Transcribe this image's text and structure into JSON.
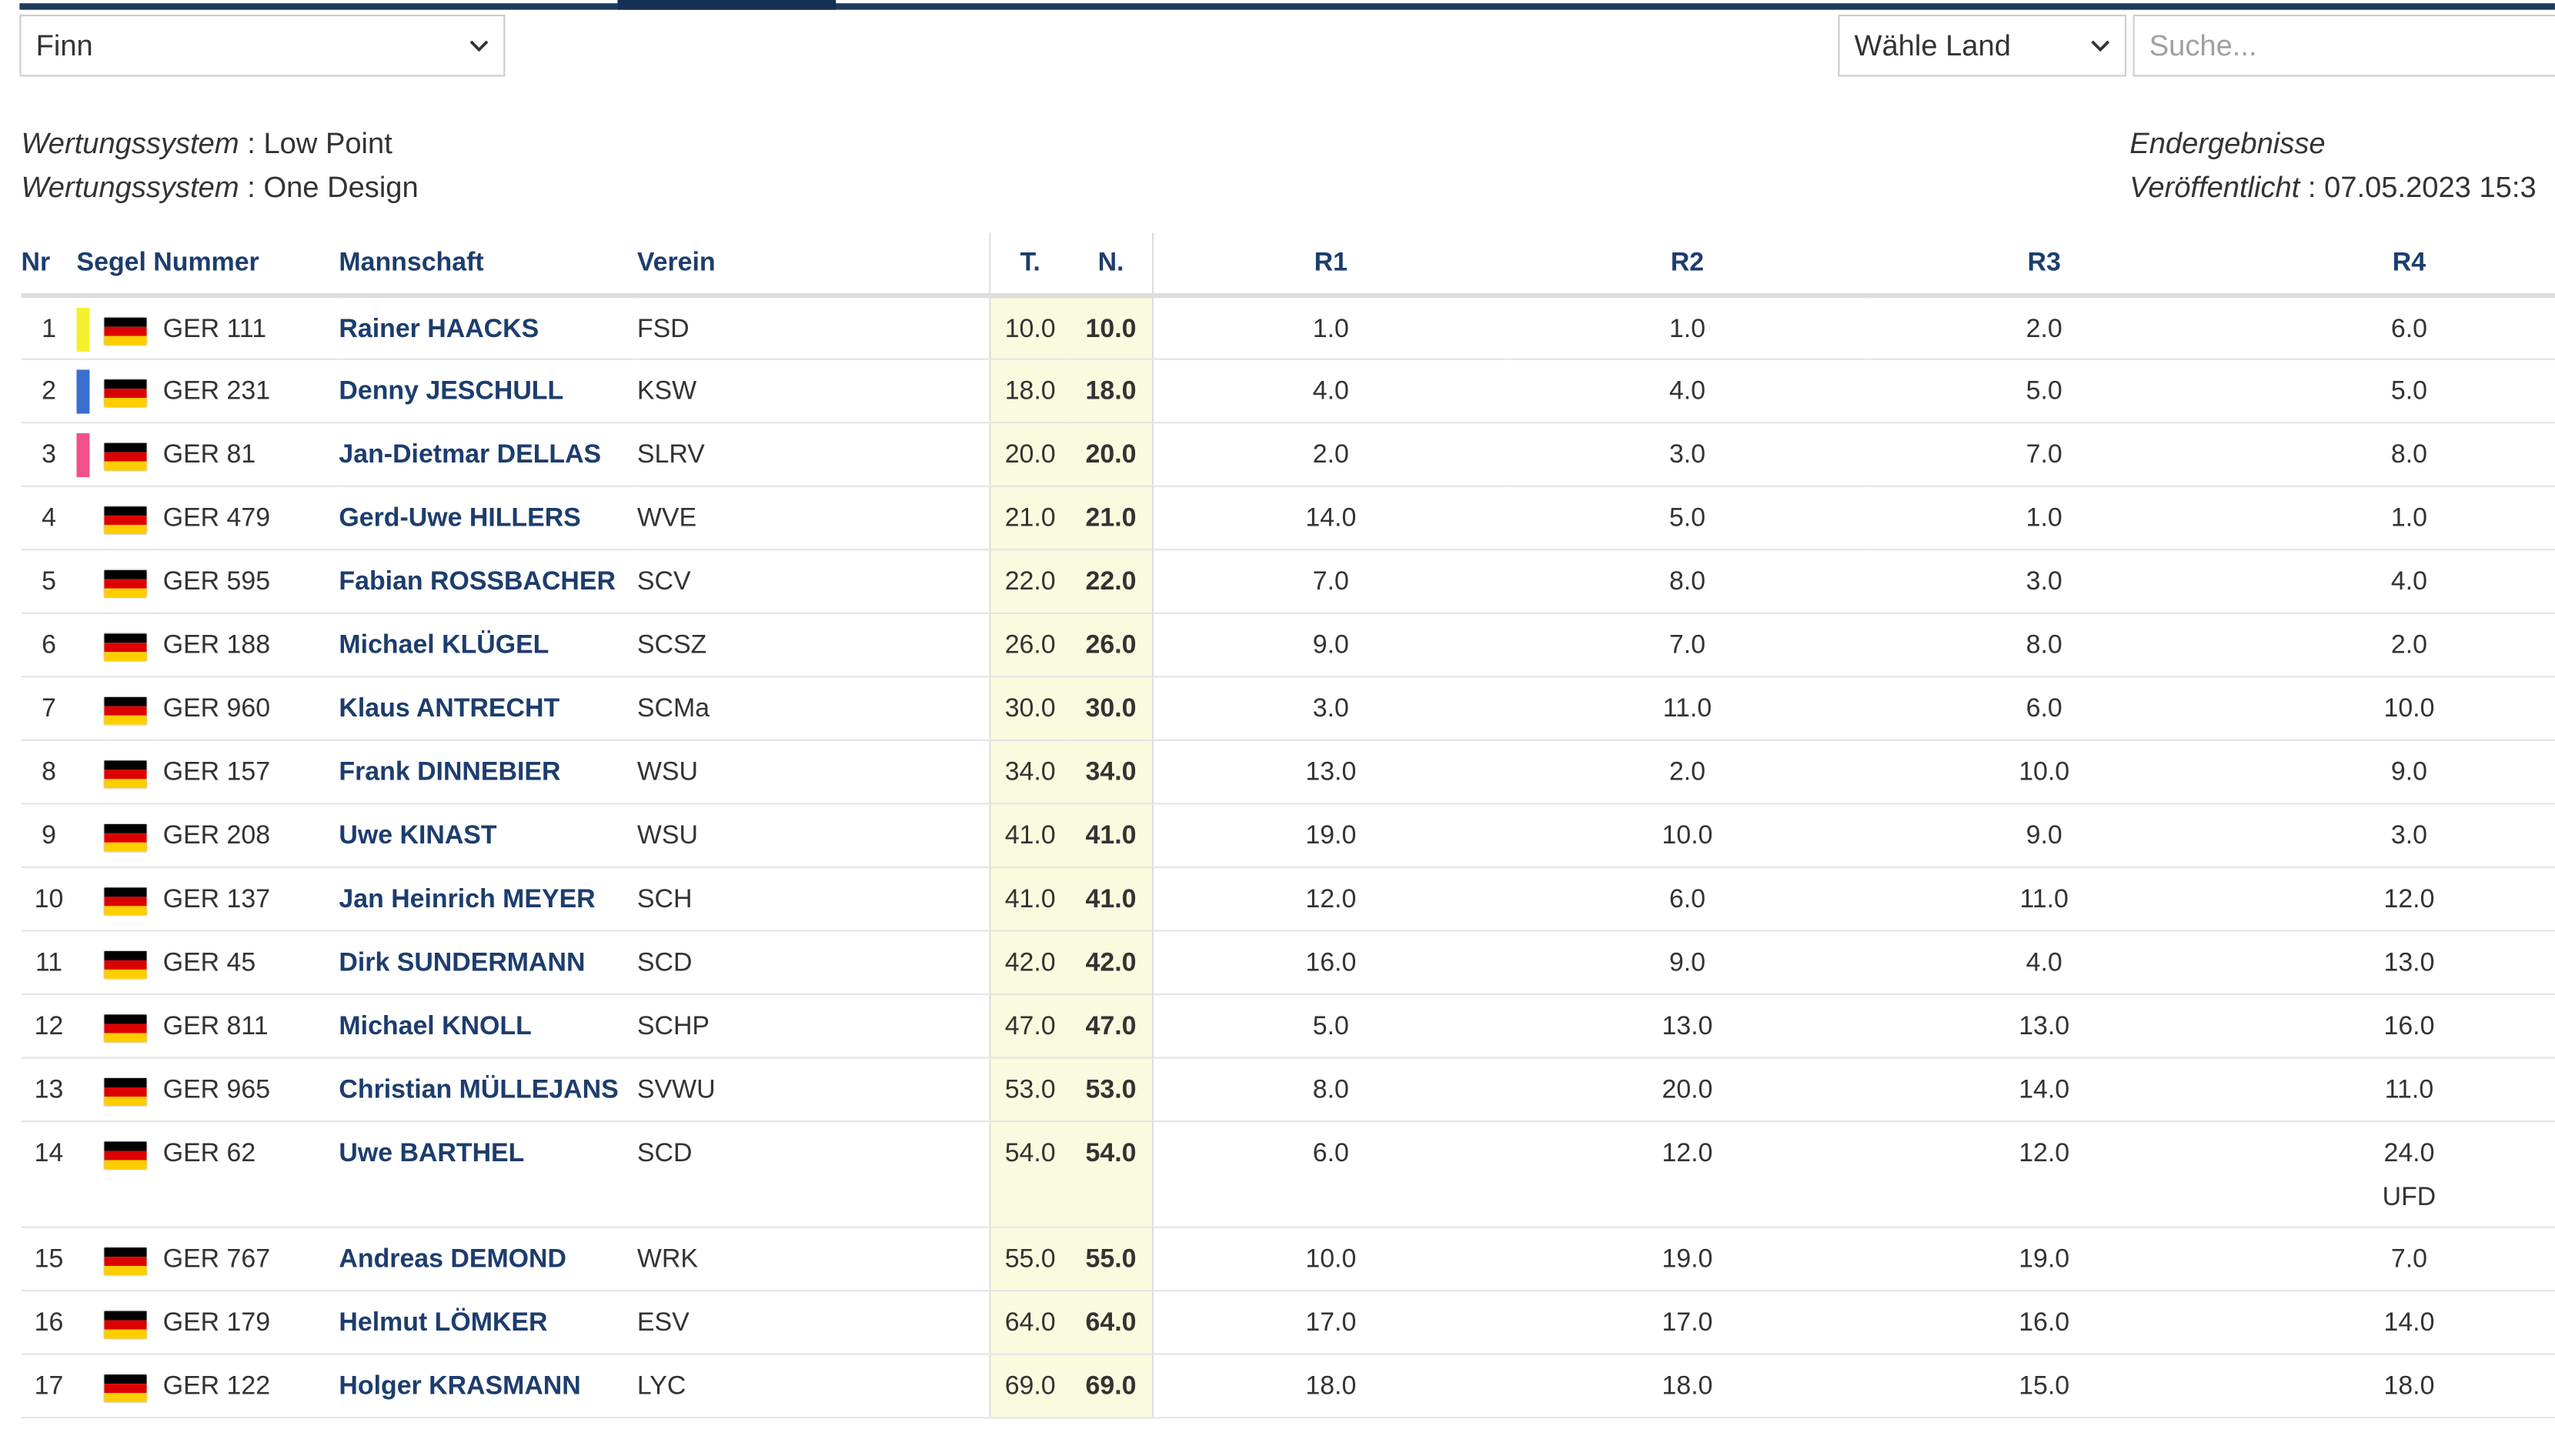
{
  "controls": {
    "class_select": "Finn",
    "country_select": "Wähle Land",
    "search_placeholder": "Suche..."
  },
  "info": {
    "scoring_label": "Wertungssystem",
    "scoring_value_1": "Low Point",
    "scoring_value_2": "One Design",
    "status": "Endergebnisse",
    "published_label": "Veröffentlicht",
    "published_value": "07.05.2023 15:3"
  },
  "table": {
    "headers": {
      "nr": "Nr",
      "sail": "Segel Nummer",
      "crew": "Mannschaft",
      "club": "Verein",
      "total": "T.",
      "net": "N.",
      "r1": "R1",
      "r2": "R2",
      "r3": "R3",
      "r4": "R4"
    },
    "medal_colors": {
      "gold": "#f4f030",
      "silver": "#3a6fd0",
      "bronze": "#f0508c"
    },
    "flag_colors": [
      "#000000",
      "#dd0000",
      "#ffce00"
    ],
    "flag_icon": "germany-flag-icon",
    "rows": [
      {
        "nr": "1",
        "medal": "gold",
        "sail": "GER 111",
        "name": "Rainer HAACKS",
        "club": "FSD",
        "t": "10.0",
        "n": "10.0",
        "r1": "1.0",
        "r2": "1.0",
        "r3": "2.0",
        "r4": "6.0",
        "r4_note": ""
      },
      {
        "nr": "2",
        "medal": "silver",
        "sail": "GER 231",
        "name": "Denny JESCHULL",
        "club": "KSW",
        "t": "18.0",
        "n": "18.0",
        "r1": "4.0",
        "r2": "4.0",
        "r3": "5.0",
        "r4": "5.0",
        "r4_note": ""
      },
      {
        "nr": "3",
        "medal": "bronze",
        "sail": "GER 81",
        "name": "Jan-Dietmar DELLAS",
        "club": "SLRV",
        "t": "20.0",
        "n": "20.0",
        "r1": "2.0",
        "r2": "3.0",
        "r3": "7.0",
        "r4": "8.0",
        "r4_note": ""
      },
      {
        "nr": "4",
        "medal": "",
        "sail": "GER 479",
        "name": "Gerd-Uwe HILLERS",
        "club": "WVE",
        "t": "21.0",
        "n": "21.0",
        "r1": "14.0",
        "r2": "5.0",
        "r3": "1.0",
        "r4": "1.0",
        "r4_note": ""
      },
      {
        "nr": "5",
        "medal": "",
        "sail": "GER 595",
        "name": "Fabian ROSSBACHER",
        "club": "SCV",
        "t": "22.0",
        "n": "22.0",
        "r1": "7.0",
        "r2": "8.0",
        "r3": "3.0",
        "r4": "4.0",
        "r4_note": ""
      },
      {
        "nr": "6",
        "medal": "",
        "sail": "GER 188",
        "name": "Michael KLÜGEL",
        "club": "SCSZ",
        "t": "26.0",
        "n": "26.0",
        "r1": "9.0",
        "r2": "7.0",
        "r3": "8.0",
        "r4": "2.0",
        "r4_note": ""
      },
      {
        "nr": "7",
        "medal": "",
        "sail": "GER 960",
        "name": "Klaus ANTRECHT",
        "club": "SCMa",
        "t": "30.0",
        "n": "30.0",
        "r1": "3.0",
        "r2": "11.0",
        "r3": "6.0",
        "r4": "10.0",
        "r4_note": ""
      },
      {
        "nr": "8",
        "medal": "",
        "sail": "GER 157",
        "name": "Frank DINNEBIER",
        "club": "WSU",
        "t": "34.0",
        "n": "34.0",
        "r1": "13.0",
        "r2": "2.0",
        "r3": "10.0",
        "r4": "9.0",
        "r4_note": ""
      },
      {
        "nr": "9",
        "medal": "",
        "sail": "GER 208",
        "name": "Uwe KINAST",
        "club": "WSU",
        "t": "41.0",
        "n": "41.0",
        "r1": "19.0",
        "r2": "10.0",
        "r3": "9.0",
        "r4": "3.0",
        "r4_note": ""
      },
      {
        "nr": "10",
        "medal": "",
        "sail": "GER 137",
        "name": "Jan Heinrich MEYER",
        "club": "SCH",
        "t": "41.0",
        "n": "41.0",
        "r1": "12.0",
        "r2": "6.0",
        "r3": "11.0",
        "r4": "12.0",
        "r4_note": ""
      },
      {
        "nr": "11",
        "medal": "",
        "sail": "GER 45",
        "name": "Dirk SUNDERMANN",
        "club": "SCD",
        "t": "42.0",
        "n": "42.0",
        "r1": "16.0",
        "r2": "9.0",
        "r3": "4.0",
        "r4": "13.0",
        "r4_note": ""
      },
      {
        "nr": "12",
        "medal": "",
        "sail": "GER 811",
        "name": "Michael KNOLL",
        "club": "SCHP",
        "t": "47.0",
        "n": "47.0",
        "r1": "5.0",
        "r2": "13.0",
        "r3": "13.0",
        "r4": "16.0",
        "r4_note": ""
      },
      {
        "nr": "13",
        "medal": "",
        "sail": "GER 965",
        "name": "Christian MÜLLEJANS",
        "club": "SVWU",
        "t": "53.0",
        "n": "53.0",
        "r1": "8.0",
        "r2": "20.0",
        "r3": "14.0",
        "r4": "11.0",
        "r4_note": ""
      },
      {
        "nr": "14",
        "medal": "",
        "sail": "GER 62",
        "name": "Uwe BARTHEL",
        "club": "SCD",
        "t": "54.0",
        "n": "54.0",
        "r1": "6.0",
        "r2": "12.0",
        "r3": "12.0",
        "r4": "24.0",
        "r4_note": "UFD"
      },
      {
        "nr": "15",
        "medal": "",
        "sail": "GER 767",
        "name": "Andreas DEMOND",
        "club": "WRK",
        "t": "55.0",
        "n": "55.0",
        "r1": "10.0",
        "r2": "19.0",
        "r3": "19.0",
        "r4": "7.0",
        "r4_note": ""
      },
      {
        "nr": "16",
        "medal": "",
        "sail": "GER 179",
        "name": "Helmut LÖMKER",
        "club": "ESV",
        "t": "64.0",
        "n": "64.0",
        "r1": "17.0",
        "r2": "17.0",
        "r3": "16.0",
        "r4": "14.0",
        "r4_note": ""
      },
      {
        "nr": "17",
        "medal": "",
        "sail": "GER 122",
        "name": "Holger KRASMANN",
        "club": "LYC",
        "t": "69.0",
        "n": "69.0",
        "r1": "18.0",
        "r2": "18.0",
        "r3": "15.0",
        "r4": "18.0",
        "r4_note": ""
      }
    ]
  }
}
